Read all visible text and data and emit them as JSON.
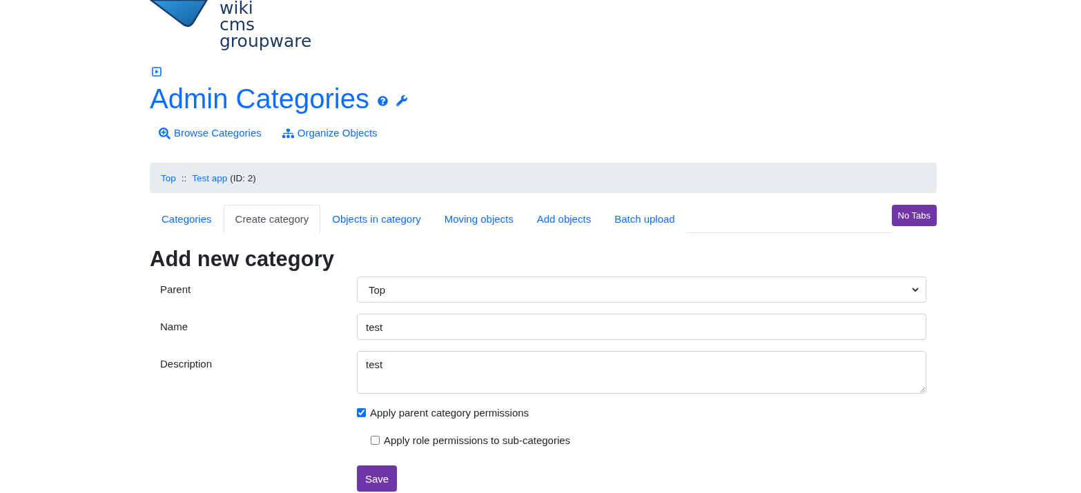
{
  "logo": {
    "lines": [
      "wiki",
      "cms",
      "groupware"
    ]
  },
  "page": {
    "title": "Admin Categories"
  },
  "actions": [
    {
      "kind": "browse",
      "label": "Browse Categories"
    },
    {
      "kind": "organize",
      "label": "Organize Objects"
    }
  ],
  "breadcrumb": {
    "items": [
      {
        "label": "Top"
      },
      {
        "label": "Test app"
      }
    ],
    "separator": "::",
    "suffix": "(ID: 2)"
  },
  "tabs": [
    {
      "label": "Categories",
      "selected": false
    },
    {
      "label": "Create category",
      "selected": true
    },
    {
      "label": "Objects in category",
      "selected": false
    },
    {
      "label": "Moving objects",
      "selected": false
    },
    {
      "label": "Add objects",
      "selected": false
    },
    {
      "label": "Batch upload",
      "selected": false
    }
  ],
  "no_tabs_button": "No Tabs",
  "form": {
    "heading": "Add new category",
    "fields": [
      {
        "kind": "select",
        "label": "Parent",
        "value": "Top"
      },
      {
        "kind": "text",
        "label": "Name",
        "value": "test"
      },
      {
        "kind": "textarea",
        "label": "Description",
        "value": "test"
      }
    ],
    "checkboxes": [
      {
        "label": "Apply parent category permissions",
        "checked": true,
        "children": [
          {
            "label": "Apply role permissions to sub-categories",
            "checked": false
          }
        ]
      }
    ],
    "submit": "Save"
  }
}
